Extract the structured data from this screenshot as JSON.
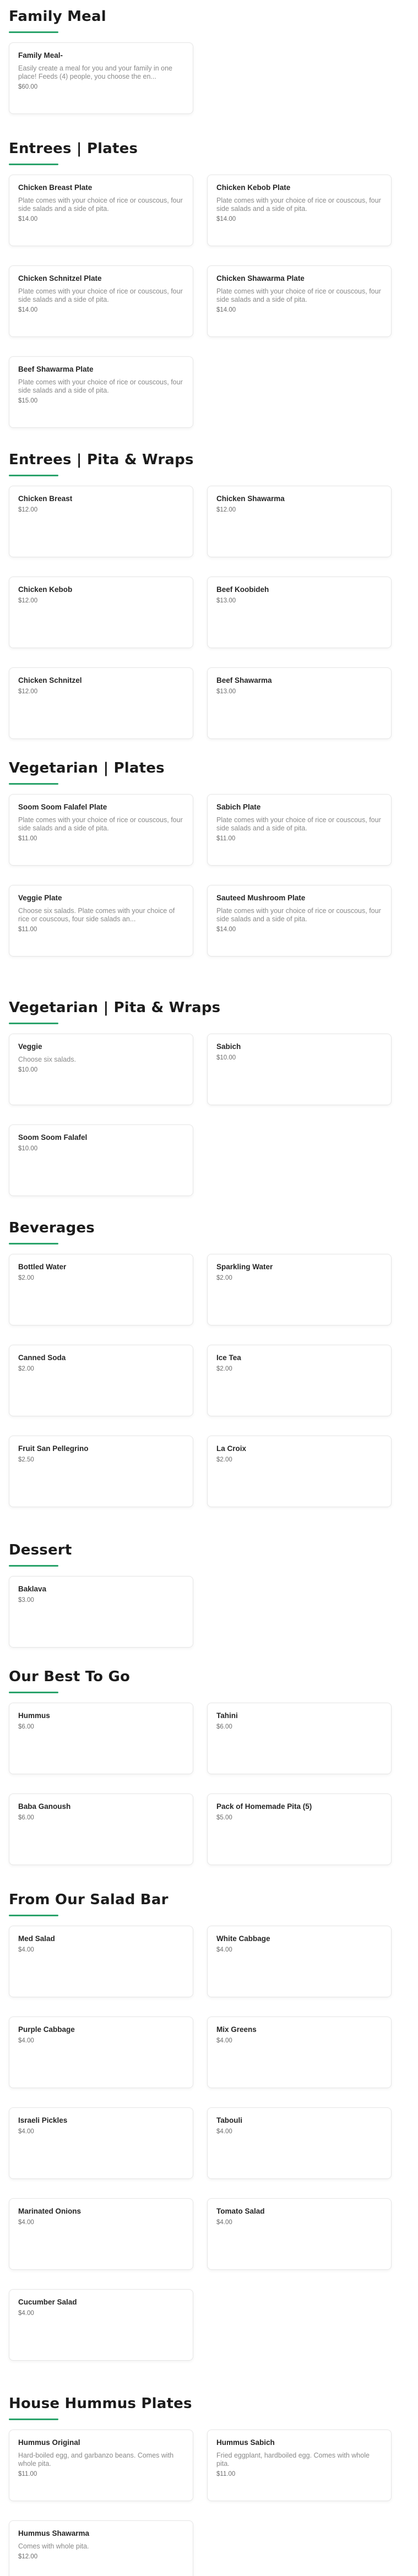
{
  "menu": {
    "sections": [
      {
        "title": "Family Meal",
        "items": [
          {
            "name": "Family Meal-",
            "description": "Easily create a meal for you and your family in one place! Feeds (4) people, you choose the en...",
            "price": "$60.00"
          }
        ]
      },
      {
        "title": "Entrees | Plates",
        "items": [
          {
            "name": "Chicken Breast Plate",
            "description": "Plate comes with your choice of rice or couscous, four side salads and a side of pita.",
            "price": "$14.00"
          },
          {
            "name": "Chicken Kebob Plate",
            "description": "Plate comes with your choice of rice or couscous, four side salads and a side of pita.",
            "price": "$14.00"
          },
          {
            "name": "Chicken Schnitzel Plate",
            "description": "Plate comes with your choice of rice or couscous, four side salads and a side of pita.",
            "price": "$14.00"
          },
          {
            "name": "Chicken Shawarma Plate",
            "description": "Plate comes with your choice of rice or couscous, four side salads and a side of pita.",
            "price": "$14.00"
          },
          {
            "name": "Beef Shawarma Plate",
            "description": "Plate comes with your choice of rice or couscous, four side salads and a side of pita.",
            "price": "$15.00"
          }
        ]
      },
      {
        "title": "Entrees | Pita & Wraps",
        "items": [
          {
            "name": "Chicken Breast",
            "description": "",
            "price": "$12.00"
          },
          {
            "name": "Chicken Shawarma",
            "description": "",
            "price": "$12.00"
          },
          {
            "name": "Chicken Kebob",
            "description": "",
            "price": "$12.00"
          },
          {
            "name": "Beef Koobideh",
            "description": "",
            "price": "$13.00"
          },
          {
            "name": "Chicken Schnitzel",
            "description": "",
            "price": "$12.00"
          },
          {
            "name": "Beef Shawarma",
            "description": "",
            "price": "$13.00"
          }
        ]
      },
      {
        "title": "Vegetarian | Plates",
        "items": [
          {
            "name": "Soom Soom Falafel Plate",
            "description": "Plate comes with your choice of rice or couscous, four side salads and a side of pita.",
            "price": "$11.00"
          },
          {
            "name": "Sabich Plate",
            "description": "Plate comes with your choice of rice or couscous, four side salads and a side of pita.",
            "price": "$11.00"
          },
          {
            "name": "Veggie Plate",
            "description": "Choose six salads. Plate comes with your choice of rice or couscous, four side salads an...",
            "price": "$11.00"
          },
          {
            "name": "Sauteed Mushroom Plate",
            "description": "Plate comes with your choice of rice or couscous, four side salads and a side of pita.",
            "price": "$14.00"
          }
        ]
      },
      {
        "title": "Vegetarian | Pita & Wraps",
        "items": [
          {
            "name": "Veggie",
            "description": "Choose six salads.",
            "price": "$10.00"
          },
          {
            "name": "Sabich",
            "description": "",
            "price": "$10.00"
          },
          {
            "name": "Soom Soom Falafel",
            "description": "",
            "price": "$10.00"
          }
        ]
      },
      {
        "title": "Beverages",
        "items": [
          {
            "name": "Bottled Water",
            "description": "",
            "price": "$2.00"
          },
          {
            "name": "Sparkling Water",
            "description": "",
            "price": "$2.00"
          },
          {
            "name": "Canned Soda",
            "description": "",
            "price": "$2.00"
          },
          {
            "name": "Ice Tea",
            "description": "",
            "price": "$2.00"
          },
          {
            "name": "Fruit San Pellegrino",
            "description": "",
            "price": "$2.50"
          },
          {
            "name": "La Croix",
            "description": "",
            "price": "$2.00"
          }
        ]
      },
      {
        "title": "Dessert",
        "items": [
          {
            "name": "Baklava",
            "description": "",
            "price": "$3.00"
          }
        ]
      },
      {
        "title": "Our Best To Go",
        "items": [
          {
            "name": "Hummus",
            "description": "",
            "price": "$6.00"
          },
          {
            "name": "Tahini",
            "description": "",
            "price": "$6.00"
          },
          {
            "name": "Baba Ganoush",
            "description": "",
            "price": "$6.00"
          },
          {
            "name": "Pack of Homemade Pita (5)",
            "description": "",
            "price": "$5.00"
          }
        ]
      },
      {
        "title": "From Our Salad Bar",
        "items": [
          {
            "name": "Med Salad",
            "description": "",
            "price": "$4.00"
          },
          {
            "name": "White Cabbage",
            "description": "",
            "price": "$4.00"
          },
          {
            "name": "Purple Cabbage",
            "description": "",
            "price": "$4.00"
          },
          {
            "name": "Mix Greens",
            "description": "",
            "price": "$4.00"
          },
          {
            "name": "Israeli Pickles",
            "description": "",
            "price": "$4.00"
          },
          {
            "name": "Tabouli",
            "description": "",
            "price": "$4.00"
          },
          {
            "name": "Marinated Onions",
            "description": "",
            "price": "$4.00"
          },
          {
            "name": "Tomato Salad",
            "description": "",
            "price": "$4.00"
          },
          {
            "name": "Cucumber Salad",
            "description": "",
            "price": "$4.00"
          }
        ]
      },
      {
        "title": "House Hummus Plates",
        "items": [
          {
            "name": "Hummus Original",
            "description": "Hard-boiled egg, and garbanzo beans. Comes with whole pita.",
            "price": "$11.00"
          },
          {
            "name": "Hummus Sabich",
            "description": "Fried eggplant, hardboiled egg. Comes with whole pita.",
            "price": "$11.00"
          },
          {
            "name": "Hummus Shawarma",
            "description": "Comes with whole pita.",
            "price": "$12.00"
          }
        ]
      }
    ]
  },
  "colors": {
    "accent_underline": "#2aa36b",
    "card_border": "#e6e6e6",
    "heading_text": "#1c1c1c",
    "description_text": "#8a8a8a",
    "price_text": "#6e6e6e"
  }
}
